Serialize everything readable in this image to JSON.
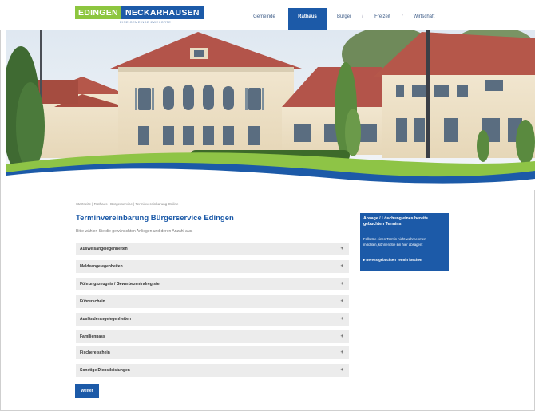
{
  "logo": {
    "part_a": "EDINGEN",
    "part_b": "NECKARHAUSEN",
    "tagline": "EINE GEMEINDE ZWEI ORTE"
  },
  "nav": {
    "items": [
      {
        "label": "Gemeinde"
      },
      {
        "label": "Rathaus"
      },
      {
        "label": "Bürger"
      },
      {
        "label": "Freizeit"
      },
      {
        "label": "Wirtschaft"
      }
    ],
    "active": "Rathaus"
  },
  "breadcrumb": "Startseite | Rathaus | Bürgerservice | Terminvereinbarung Online",
  "page": {
    "title": "Terminvereinbarung Bürgerservice Edingen",
    "intro": "Bitte wählen Sie die gewünschten Anliegen und deren Anzahl aus."
  },
  "categories": [
    {
      "label": "Ausweisangelegenheiten"
    },
    {
      "label": "Meldeangelegenheiten"
    },
    {
      "label": "Führungszeugnis / Gewerbezentralregister"
    },
    {
      "label": "Führerschein"
    },
    {
      "label": "Ausländerangelegenheiten"
    },
    {
      "label": "Familienpass"
    },
    {
      "label": "Fischereischein"
    },
    {
      "label": "Sonstige Dienstleistungen"
    }
  ],
  "expand_icon": "+",
  "next_button": "Weiter",
  "sidebox": {
    "title": "Absage / Löschung eines bereits gebuchten Termins",
    "text": "Falls Sie einen Termin nicht wahrnehmen möchten, können Sie ihn hier absagen:",
    "link": "Bereits gebuchten Termin löschen",
    "link_icon": "▸"
  },
  "colors": {
    "accent": "#1c5aa8",
    "green": "#8dc63f",
    "panel": "#ececec"
  }
}
